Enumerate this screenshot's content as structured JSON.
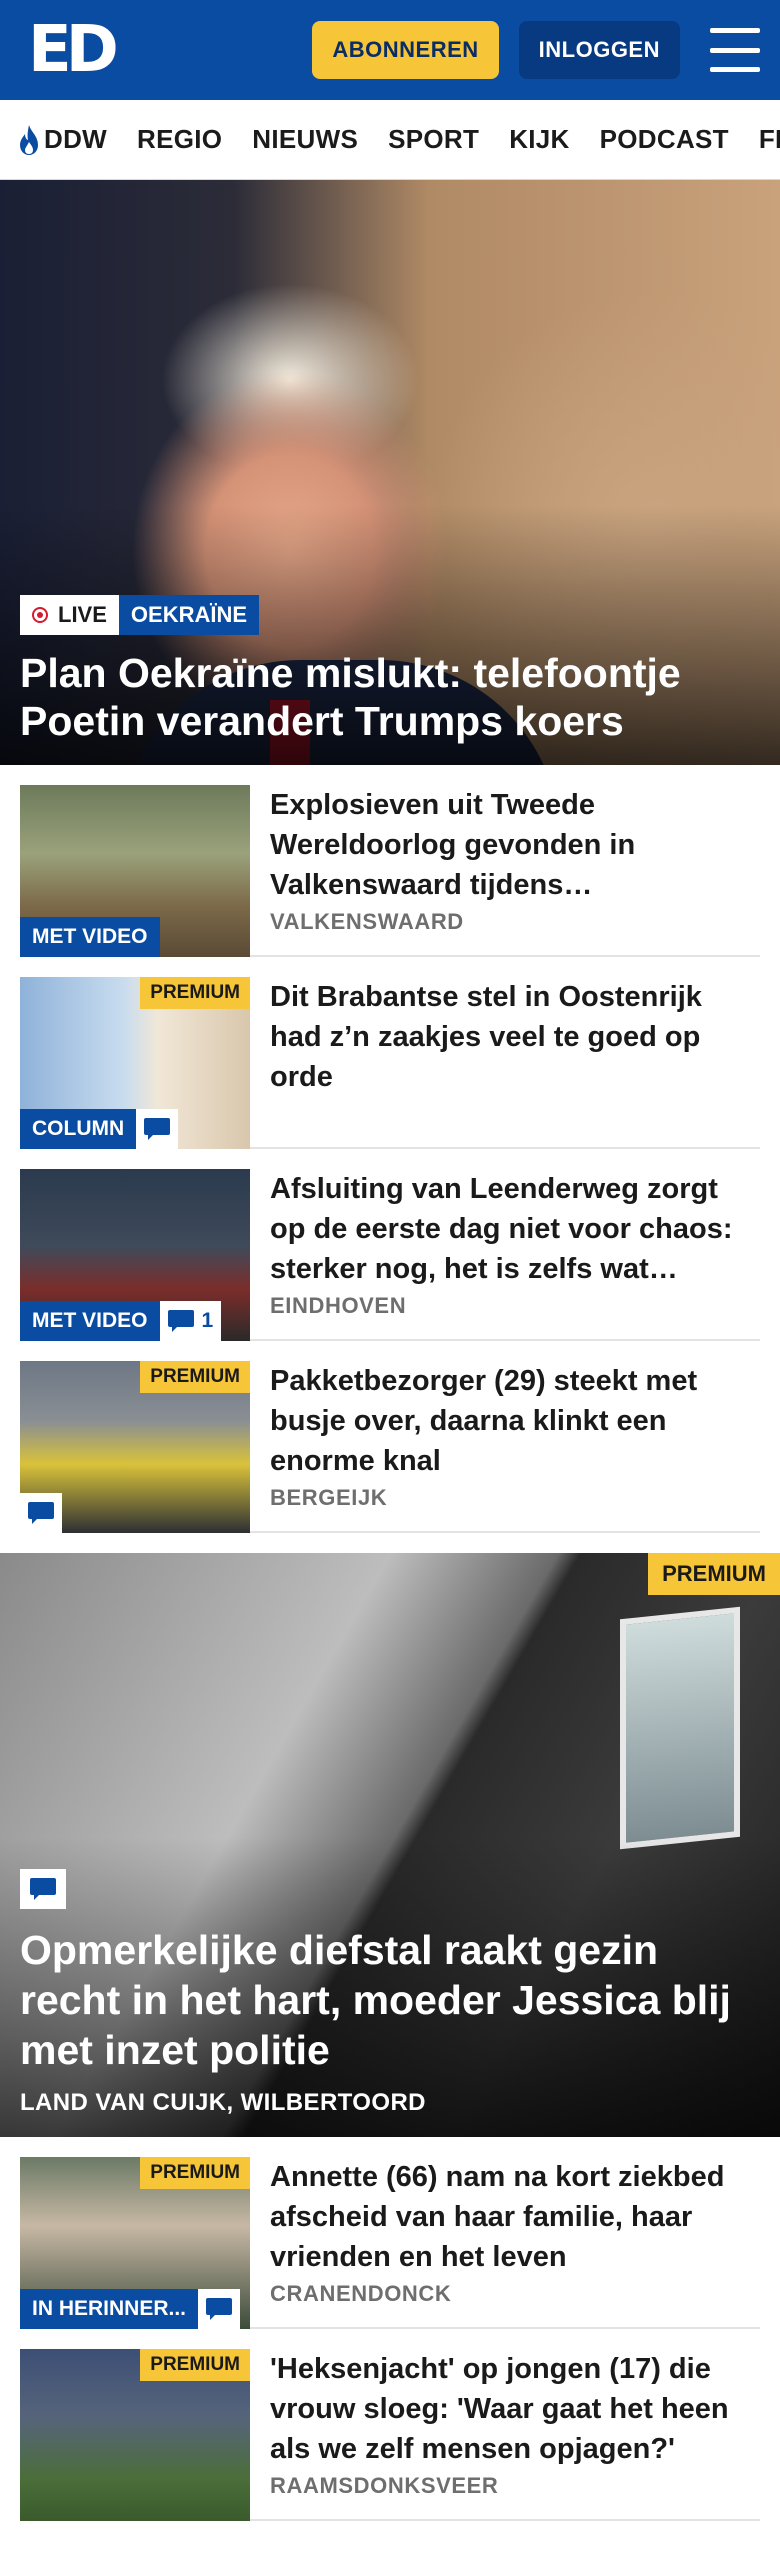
{
  "header": {
    "logo": "ED",
    "subscribe_label": "ABONNEREN",
    "login_label": "INLOGGEN",
    "menu_icon": "hamburger-menu-icon"
  },
  "nav": {
    "items": [
      {
        "label": "DDW",
        "icon": "flame-icon"
      },
      {
        "label": "REGIO"
      },
      {
        "label": "NIEUWS"
      },
      {
        "label": "SPORT"
      },
      {
        "label": "KIJK"
      },
      {
        "label": "PODCAST"
      },
      {
        "label": "FEE"
      }
    ]
  },
  "hero": {
    "live_label": "LIVE",
    "topic": "OEKRAÏNE",
    "title": "Plan Oekraïne mislukt: telefoontje Poetin verandert Trumps koers"
  },
  "articles": [
    {
      "title": "Explosieven uit Tweede Wereldoorlog gevonden in Valkenswaard tijdens graafwerkzaamheden",
      "place": "VALKENSWAARD",
      "badge": "MET VIDEO",
      "premium": ""
    },
    {
      "title": "Dit Brabantse stel in Oostenrijk had z’n zaakjes veel te goed op orde",
      "place": "",
      "badge": "COLUMN",
      "premium": "PREMIUM"
    },
    {
      "title": "Afsluiting van Leenderweg zorgt op de eerste dag niet voor chaos: sterker nog, het is zelfs wat rustiger",
      "place": "EINDHOVEN",
      "badge": "MET VIDEO",
      "comments": "1",
      "premium": ""
    },
    {
      "title": "Pakketbezorger (29) steekt met busje over, daarna klinkt een enorme knal",
      "place": "BERGEIJK",
      "premium": "PREMIUM"
    }
  ],
  "feature": {
    "premium": "PREMIUM",
    "title": "Opmerkelijke diefstal raakt gezin recht in het hart, moeder Jessica blij met inzet politie",
    "place": "LAND VAN CUIJK, WILBERTOORD"
  },
  "articles2": [
    {
      "title": "Annette (66) nam na kort ziekbed afscheid van haar familie, haar vrienden en het leven",
      "place": "CRANENDONCK",
      "badge": "IN HERINNER...",
      "premium": "PREMIUM"
    },
    {
      "title": "'Heksenjacht' op jongen (17) die vrouw sloeg: 'Waar gaat het heen als we zelf mensen opjagen?'",
      "place": "RAAMSDONKSVEER",
      "premium": "PREMIUM"
    }
  ],
  "colors": {
    "brand_blue": "#0a4ca1",
    "premium_yellow": "#f6c538",
    "live_red": "#d7192d"
  }
}
